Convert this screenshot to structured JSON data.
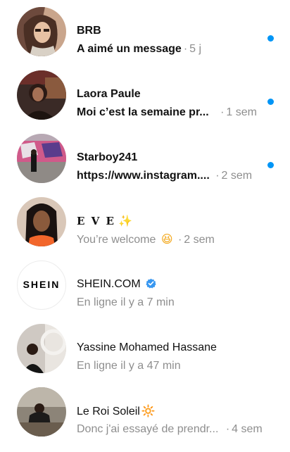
{
  "conversations": [
    {
      "name": "BRB",
      "snippet": "A aimé un message",
      "sep": "·",
      "time": "5 j",
      "unread": true
    },
    {
      "name": "Laora Paule",
      "snippet": "Moi c’est la semaine pr...",
      "sep": "·",
      "time": "1 sem",
      "unread": true
    },
    {
      "name": "Starboy241",
      "snippet": "https://www.instagram....",
      "sep": "·",
      "time": "2 sem",
      "unread": true
    },
    {
      "name": "E V E",
      "name_emoji": "✨",
      "snippet": "You’re welcome",
      "snippet_emoji": "😆",
      "sep": "·",
      "time": "2 sem",
      "unread": false
    },
    {
      "name": "SHEIN.COM",
      "avatar_text": "SHEIN",
      "snippet": "En ligne il y a 7 min",
      "verified": true,
      "unread": false
    },
    {
      "name": "Yassine Mohamed Hassane",
      "snippet": "En ligne il y a 47 min",
      "unread": false
    },
    {
      "name": "Le Roi Soleil",
      "name_emoji": "🔆",
      "snippet": "Donc j'ai essayé de prendr...",
      "sep": "·",
      "time": "4 sem",
      "unread": false
    }
  ],
  "colors": {
    "unread_dot": "#0095f6",
    "meta_text": "#8e8e8e",
    "verified_badge": "#3897f0"
  }
}
